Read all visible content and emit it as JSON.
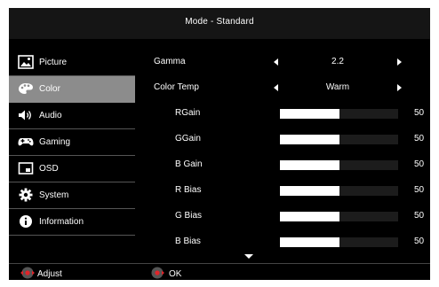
{
  "title": "Mode - Standard",
  "sidebar": {
    "items": [
      {
        "label": "Picture",
        "icon": "picture-icon",
        "active": false
      },
      {
        "label": "Color",
        "icon": "palette-icon",
        "active": true
      },
      {
        "label": "Audio",
        "icon": "speaker-icon",
        "active": false
      },
      {
        "label": "Gaming",
        "icon": "gamepad-icon",
        "active": false
      },
      {
        "label": "OSD",
        "icon": "osd-window-icon",
        "active": false
      },
      {
        "label": "System",
        "icon": "gear-icon",
        "active": false
      },
      {
        "label": "Information",
        "icon": "info-icon",
        "active": false
      }
    ]
  },
  "settings": {
    "gamma": {
      "label": "Gamma",
      "value": "2.2"
    },
    "color_temp": {
      "label": "Color Temp",
      "value": "Warm"
    },
    "sliders": [
      {
        "label": "RGain",
        "value": "50",
        "level": 50
      },
      {
        "label": "GGain",
        "value": "50",
        "level": 50
      },
      {
        "label": "B Gain",
        "value": "50",
        "level": 50
      },
      {
        "label": "R Bias",
        "value": "50",
        "level": 50
      },
      {
        "label": "G Bias",
        "value": "50",
        "level": 50
      },
      {
        "label": "B Bias",
        "value": "50",
        "level": 50
      }
    ]
  },
  "footer": {
    "adjust_label": "Adjust",
    "ok_label": "OK"
  },
  "colors": {
    "background": "#000000",
    "selected": "#8c8c8c",
    "accent_red": "#e0242a"
  }
}
